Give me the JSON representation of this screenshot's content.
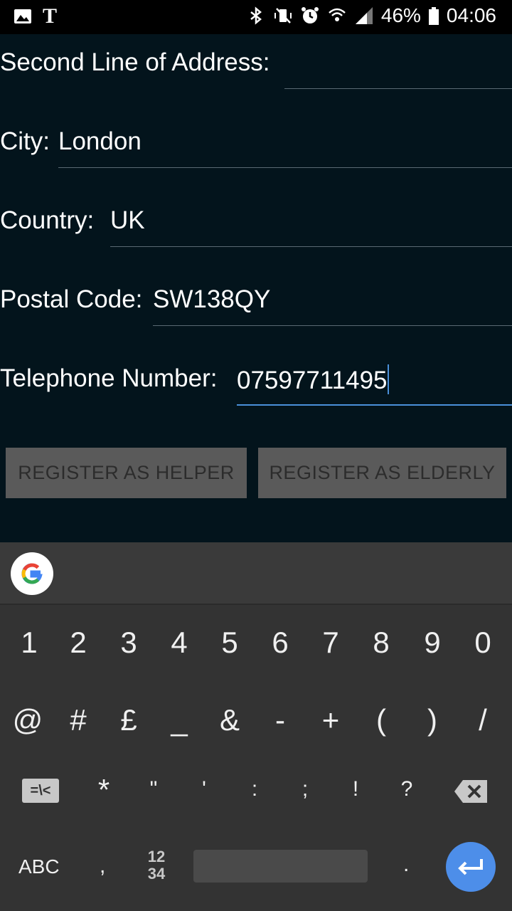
{
  "status_bar": {
    "battery": "46%",
    "time": "04:06",
    "icons": [
      "gallery-icon",
      "nyt-icon",
      "bluetooth-icon",
      "vibrate-mute-icon",
      "alarm-icon",
      "wifi-icon",
      "signal-icon",
      "battery-icon"
    ],
    "nyt_glyph": "T"
  },
  "form": {
    "second_line": {
      "label": "Second Line of Address:",
      "value": ""
    },
    "city": {
      "label": "City:",
      "value": "London"
    },
    "country": {
      "label": "Country:",
      "value": "UK"
    },
    "postal": {
      "label": "Postal Code:",
      "value": "SW138QY"
    },
    "telephone": {
      "label": "Telephone Number:",
      "value": "07597711495"
    }
  },
  "buttons": {
    "helper": "REGISTER AS HELPER",
    "elderly": "REGISTER AS ELDERLY"
  },
  "keyboard": {
    "row1": [
      "1",
      "2",
      "3",
      "4",
      "5",
      "6",
      "7",
      "8",
      "9",
      "0"
    ],
    "row2": [
      "@",
      "#",
      "£",
      "_",
      "&",
      "-",
      "+",
      "(",
      ")",
      "/"
    ],
    "row3": [
      "*",
      "\"",
      "'",
      ":",
      ";",
      "!",
      "?"
    ],
    "symbols_toggle": "=\\<",
    "abc": "ABC",
    "comma": ",",
    "numpad_top": "12",
    "numpad_bottom": "34",
    "period": "."
  },
  "colors": {
    "form_bg": "#03141c",
    "accent": "#4a90d9",
    "button_bg": "#5a5a5a",
    "keyboard_bg": "#333333",
    "enter_key": "#4d8ee9"
  }
}
